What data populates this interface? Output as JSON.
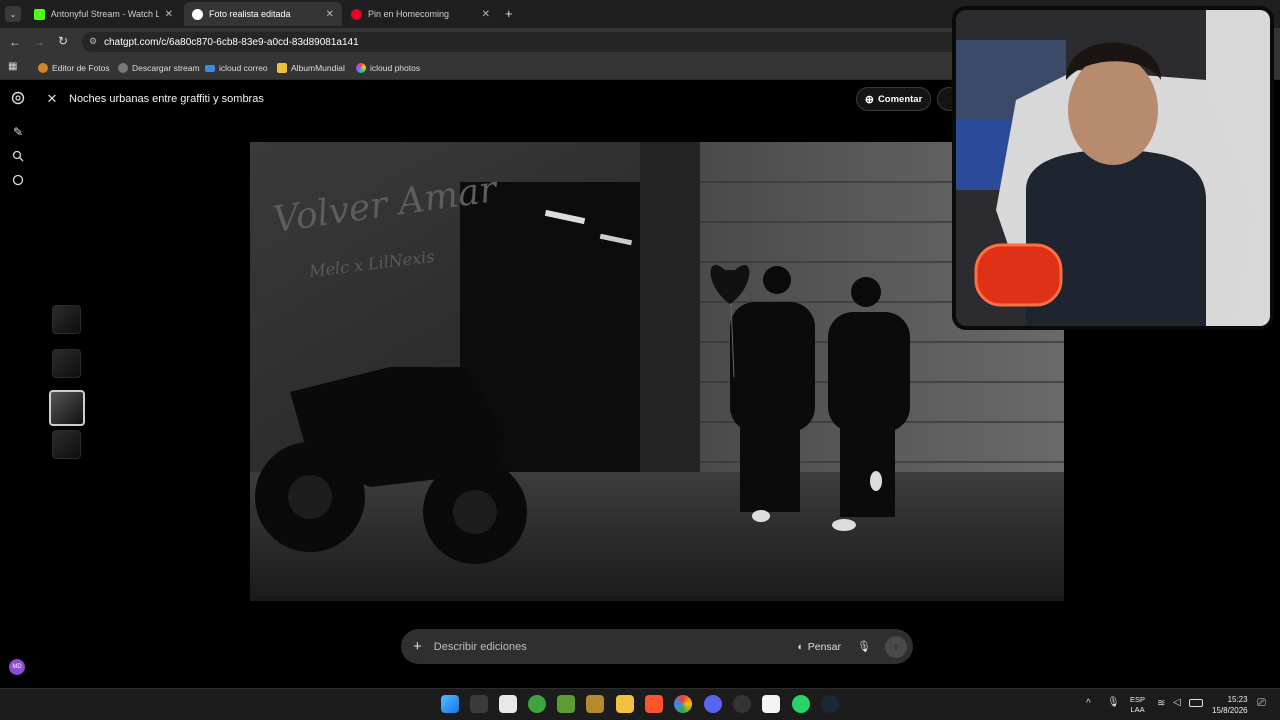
{
  "browser": {
    "tabs": [
      {
        "label": "Antonyful Stream - Watch Live",
        "active": false
      },
      {
        "label": "Foto realista editada",
        "active": true
      },
      {
        "label": "Pin en Homecoming",
        "active": false
      }
    ],
    "url": "chatgpt.com/c/6a80c870-6cb8-83e9-a0cd-83d89081a141",
    "bookmarks": [
      "Editor de Fotos",
      "Descargar stream",
      "icloud correo",
      "AlbumMundial",
      "icloud photos"
    ]
  },
  "viewer": {
    "title": "Noches urbanas entre graffiti y sombras",
    "comment_label": "Comentar",
    "avatar_initials": "MD"
  },
  "image": {
    "graffiti_title": "Volver Amar",
    "graffiti_sub": "Melc x LilNexis"
  },
  "editbar": {
    "placeholder": "Describir ediciones",
    "think_label": "Pensar"
  },
  "taskbar": {
    "lang": "ESP",
    "lang_sub": "LAA",
    "time": "15:23",
    "date": "15/8/2026"
  },
  "colors": {
    "accent_purple": "#8e4bd6",
    "tab_bg": "#1f1f1f",
    "toolbar_bg": "#353535"
  },
  "icons": [
    "chatgpt-logo-icon",
    "new-chat-icon",
    "search-icon",
    "chat-bubble-icon",
    "close-icon",
    "comment-icon",
    "plus-icon",
    "think-icon",
    "mic-icon",
    "send-icon"
  ]
}
